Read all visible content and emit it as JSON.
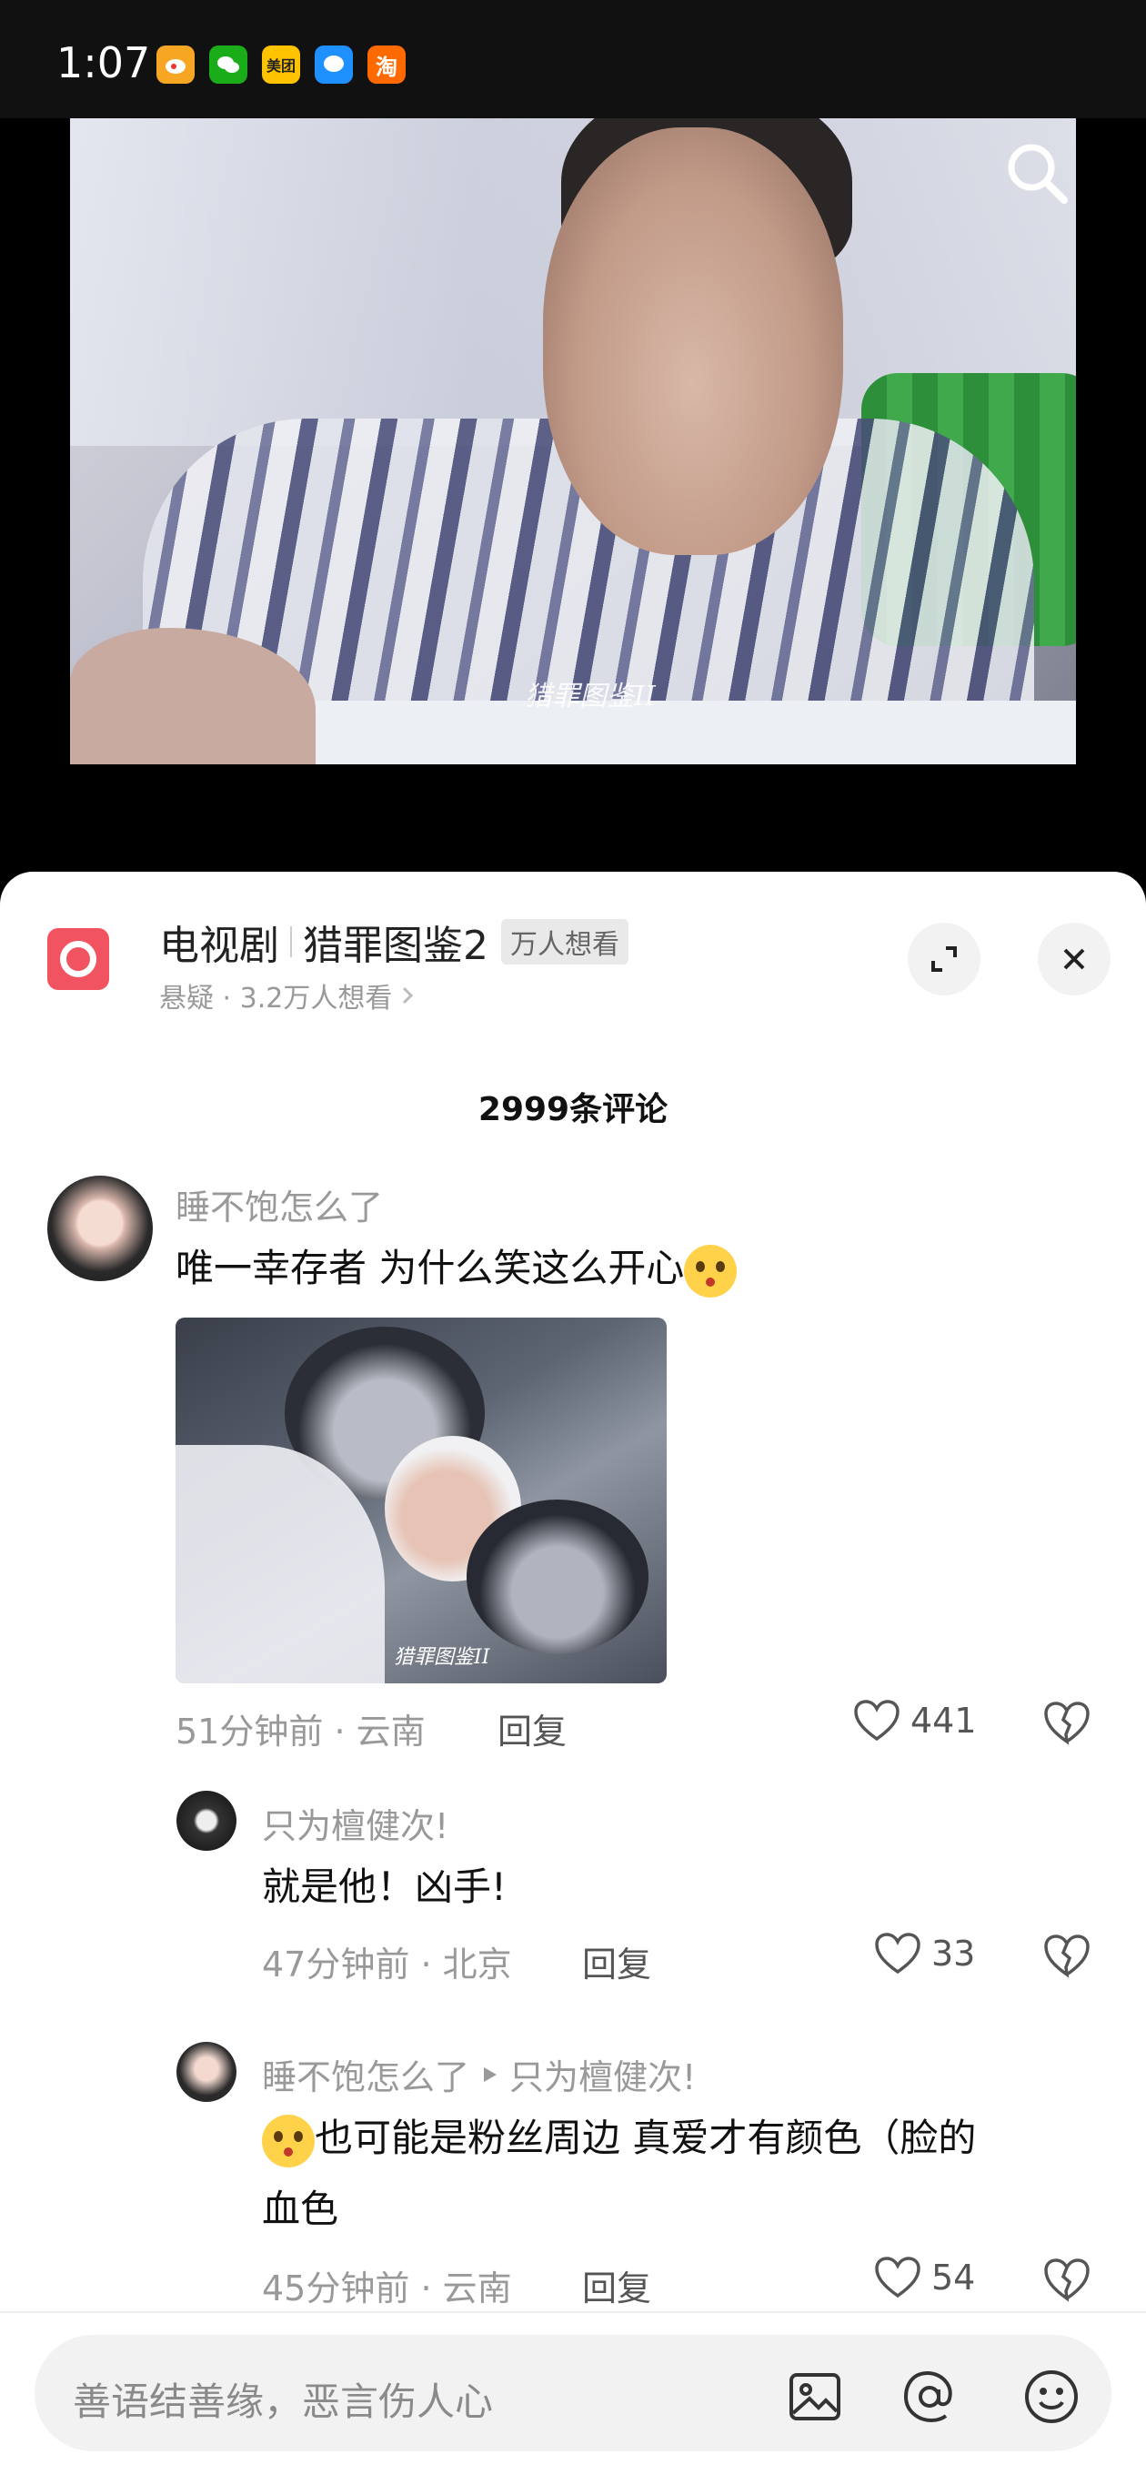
{
  "status_bar": {
    "time": "1:07",
    "app_icons": [
      {
        "name": "weibo-icon",
        "label": "",
        "color": "#f6a623"
      },
      {
        "name": "wechat-icon",
        "label": "",
        "color": "#1aad19"
      },
      {
        "name": "meituan-icon",
        "label": "美团",
        "color": "#ffc300"
      },
      {
        "name": "message-icon",
        "label": "",
        "color": "#1e90ff"
      },
      {
        "name": "taobao-icon",
        "label": "淘",
        "color": "#ff6a00"
      }
    ]
  },
  "video": {
    "watermark": "猎罪图鉴II"
  },
  "drama": {
    "category": "电视剧",
    "title": "猎罪图鉴2",
    "tag": "万人想看",
    "subtitle": "悬疑 · 3.2万人想看"
  },
  "comments_header": "2999条评论",
  "comments": [
    {
      "user": "睡不饱怎么了",
      "text": "唯一幸存者 为什么笑这么开心",
      "time": "51分钟前",
      "location": "云南",
      "reply_label": "回复",
      "likes": "441"
    },
    {
      "user": "只为檀健次!",
      "text": "就是他！凶手!",
      "time": "47分钟前",
      "location": "北京",
      "reply_label": "回复",
      "likes": "33"
    },
    {
      "user": "睡不饱怎么了",
      "reply_to": "只为檀健次!",
      "text_line1": "也可能是粉丝周边 真爱才有颜色（脸的",
      "text_line2": "血色",
      "time": "45分钟前",
      "location": "云南",
      "reply_label": "回复",
      "likes": "54"
    }
  ],
  "input": {
    "placeholder": "善语结善缘，恶言伤人心"
  },
  "colors": {
    "accent": "#f25360",
    "text_gray": "#999999"
  }
}
